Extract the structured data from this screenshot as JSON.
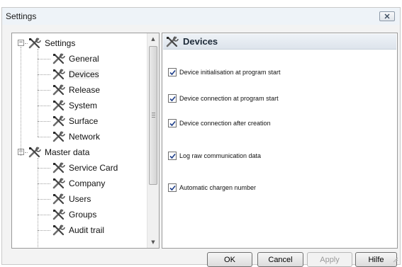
{
  "window": {
    "title": "Settings"
  },
  "tree": {
    "items": [
      {
        "label": "Settings",
        "level": 0,
        "expanded": true
      },
      {
        "label": "General",
        "level": 1
      },
      {
        "label": "Devices",
        "level": 1,
        "selected": true
      },
      {
        "label": "Release",
        "level": 1
      },
      {
        "label": "System",
        "level": 1
      },
      {
        "label": "Surface",
        "level": 1
      },
      {
        "label": "Network",
        "level": 1
      },
      {
        "label": "Master data",
        "level": 0,
        "expanded": true
      },
      {
        "label": "Service Card",
        "level": 1
      },
      {
        "label": "Company",
        "level": 1
      },
      {
        "label": "Users",
        "level": 1
      },
      {
        "label": "Groups",
        "level": 1
      },
      {
        "label": "Audit trail",
        "level": 1
      }
    ],
    "icon": "tools-icon"
  },
  "details": {
    "title": "Devices",
    "options": [
      {
        "label": "Device initialisation at program start",
        "checked": true
      },
      {
        "label": "Device connection at program start",
        "checked": true
      },
      {
        "label": "Device connection after creation",
        "checked": true
      },
      {
        "label": "Log raw communication data",
        "checked": true
      },
      {
        "label": "Automatic chargen number",
        "checked": true
      }
    ]
  },
  "buttons": {
    "ok": "OK",
    "cancel": "Cancel",
    "apply": "Apply",
    "help": "Hilfe"
  },
  "colors": {
    "header_bg": "#dde4ec",
    "window_bg": "#f3f3f3"
  }
}
